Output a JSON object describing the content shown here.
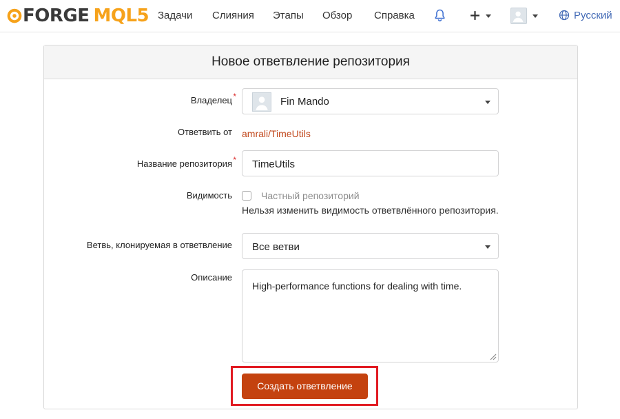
{
  "brand": {
    "part1": "FORGE",
    "part2": "MQL5"
  },
  "nav": {
    "items": [
      {
        "label": "Задачи"
      },
      {
        "label": "Слияния"
      },
      {
        "label": "Этапы"
      },
      {
        "label": "Обзор"
      },
      {
        "label": "Справка"
      }
    ],
    "language": "Русский",
    "icons": [
      "bell-icon",
      "plus-icon",
      "avatar-icon",
      "globe-icon"
    ]
  },
  "form": {
    "title": "Новое ответвление репозитория",
    "owner": {
      "label": "Владелец",
      "required_mark": "*",
      "value": "Fin Mando"
    },
    "fork_from": {
      "label": "Ответвить от",
      "value": "amrali/TimeUtils"
    },
    "repo_name": {
      "label": "Название репозитория",
      "required_mark": "*",
      "value": "TimeUtils"
    },
    "visibility": {
      "label": "Видимость",
      "checkbox_label": "Частный репозиторий",
      "checked": false,
      "help": "Нельзя изменить видимость ответвлённого репозитория."
    },
    "branches": {
      "label": "Ветвь, клонируемая в ответвление",
      "value": "Все ветви"
    },
    "description": {
      "label": "Описание",
      "value": "High-performance functions for dealing with time."
    },
    "submit_label": "Создать ответвление"
  },
  "colors": {
    "accent": "#c4420f",
    "link": "#c1471b",
    "brand_orange": "#f6a21a",
    "highlight": "#e11b22"
  }
}
